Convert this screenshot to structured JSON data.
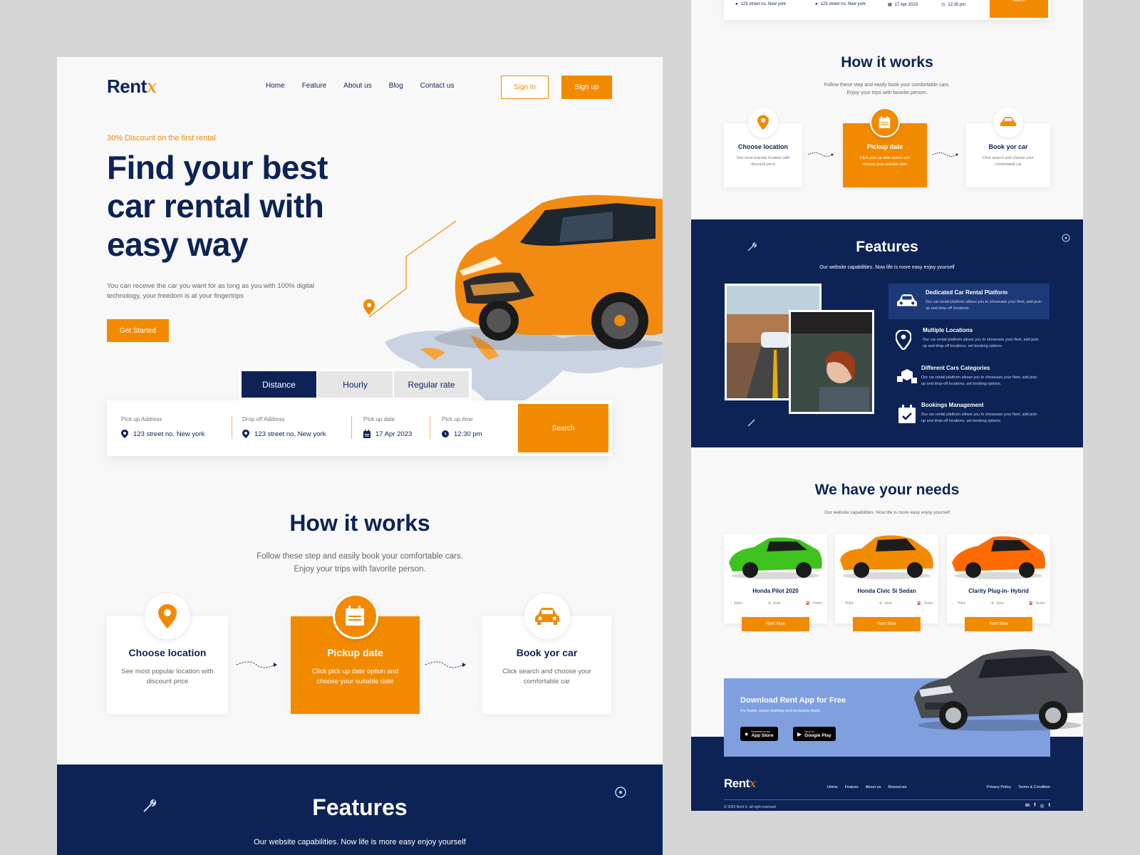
{
  "brand": {
    "name": "Rent",
    "mark": "x"
  },
  "nav": [
    "Home",
    "Feature",
    "About us",
    "Blog",
    "Contact us"
  ],
  "auth": {
    "signin": "Sign In",
    "signup": "Sign up"
  },
  "hero": {
    "discount": "30% Discount on the first rental",
    "title": "Find your best car rental with easy way",
    "subtitle": "You can receive the car you want for as long as you with 100% digital technology, your freedom is at your fingertrips",
    "cta": "Get Started"
  },
  "booking": {
    "tabs": [
      "Distance",
      "Hourly",
      "Regular rate"
    ],
    "active_tab": "Distance",
    "fields": [
      {
        "label": "Pick up Address",
        "value": "123 street no, New york",
        "icon": "location-pin-icon"
      },
      {
        "label": "Drop off Address",
        "value": "123 street no, New york",
        "icon": "location-pin-icon"
      },
      {
        "label": "Pick up date",
        "value": "17 Apr 2023",
        "icon": "calendar-icon"
      },
      {
        "label": "Pick up time",
        "value": "12:30 pm",
        "icon": "clock-icon"
      }
    ],
    "search": "Search"
  },
  "how": {
    "title": "How it works",
    "subtitle": "Follow these step and easily book your comfortable cars. Enjoy your trips with favorite person.",
    "steps": [
      {
        "title": "Choose location",
        "desc": "See most popular location with discount price",
        "icon": "location-pin-icon"
      },
      {
        "title": "Pickup date",
        "desc": "Click pick up date option and choose your suitable date",
        "icon": "calendar-icon"
      },
      {
        "title": "Book yor car",
        "desc": "Click search and choose your comfortable car",
        "icon": "car-icon"
      }
    ]
  },
  "features": {
    "title": "Features",
    "subtitle": "Our website capabilities. Now life is more easy enjoy yourself",
    "items": [
      {
        "title": "Dedicated Car Rental Platform",
        "desc": "Our car rental platform allows you to showcase your fleet, add pick-up and drop-off locations."
      },
      {
        "title": "Multiple Locations",
        "desc": "Our car rental platform allows you to showcase your fleet, add pick-up and drop-off locations, set booking options."
      },
      {
        "title": "Different Cars Categories",
        "desc": "Our car rental platform allows you to showcase your fleet, add pick-up and drop-off locations, set booking options."
      },
      {
        "title": "Bookings Management",
        "desc": "Our car rental platform allows you to showcase your fleet, add pick-up and drop-off locations, set booking options."
      }
    ]
  },
  "needs": {
    "title": "We have your needs",
    "subtitle": "Our website capabilities. Now life is more easy enjoy yourself",
    "cars": [
      {
        "name": "Honda Pilot 2020",
        "distance": "50km",
        "transmission": "Auto",
        "fuel": "Octen",
        "cta": "Rent Now",
        "color": "#3ec21e"
      },
      {
        "name": "Honda Civic Si  Sedan",
        "distance": "50km",
        "transmission": "Auto",
        "fuel": "Octen",
        "cta": "Rent Now",
        "color": "#f28a00"
      },
      {
        "name": "Clarity Plug-in- Hybrid",
        "distance": "75km",
        "transmission": "Auto",
        "fuel": "Octen",
        "cta": "Rent Now",
        "color": "#ff6a00"
      }
    ]
  },
  "app": {
    "title": "Download Rent App for Free",
    "desc": "For faster, easier booking and exclusive deals.",
    "appstore_small": "Download on the",
    "appstore": "App Store",
    "play_small": "Get it on",
    "play": "Google Play"
  },
  "footer": {
    "links": [
      "Home",
      "Feature",
      "About us",
      "Resources"
    ],
    "legal": [
      "Privacy Policy",
      "Terms & Condition"
    ],
    "copyright": "© 2023 Rent X. all right reserved",
    "social": [
      "in",
      "f",
      "◎",
      "t"
    ]
  },
  "colors": {
    "navy": "#0d2356",
    "orange": "#f28a00",
    "app_banner": "#7f9fdf"
  }
}
